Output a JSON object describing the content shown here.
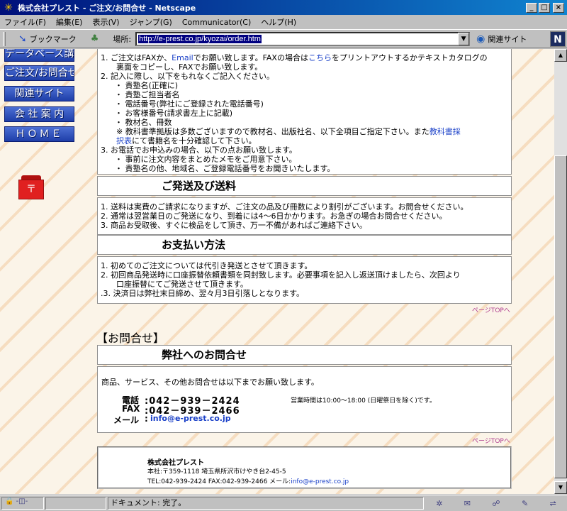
{
  "window": {
    "title": "株式会社プレスト - ご注文/お問合せ - Netscape"
  },
  "menu": [
    "ファイル(F)",
    "編集(E)",
    "表示(V)",
    "ジャンプ(G)",
    "Communicator(C)",
    "ヘルプ(H)"
  ],
  "toolbar": {
    "bookmark_label": "ブックマーク",
    "location_label": "場所:",
    "url": "http://e-prest.co.jp/kyozai/order.htm",
    "related_label": "関連サイト"
  },
  "nav": [
    "データベース講習",
    "ご注文/お問合せ",
    "関連サイト",
    "会 社 案 内",
    "ＨＯＭＥ"
  ],
  "order_steps": {
    "l1a": "1.  ご注文はFAXか、",
    "l1_email": "Email",
    "l1b": "でお願い致します。FAXの場合は",
    "l1_here": "こちら",
    "l1c": "をプリントアウトするかテキストカタログの",
    "l1d": "裏面をコピーし、FAXでお願い致します。",
    "l2": "2.  記入に際し、以下をもれなくご記入ください。",
    "b1": "・ 貴塾名(正確に)",
    "b2": "・ 貴塾ご担当者名",
    "b3": "・ 電話番号(弊社にご登録された電話番号)",
    "b4": "・ お客様番号(請求書左上に記載)",
    "b5": "・ 教材名、冊数",
    "note_a": "※ 教科書準拠版は多数ございますので教材名、出版社名、以下全項目ご指定下さい。また",
    "note_link1": "教科書採",
    "note_link2": "択表",
    "note_b": "にて書籍名を十分確認して下さい。",
    "l3": "3.  お電話でお申込みの場合、以下の点お願い致します。",
    "c1": "・ 事前に注文内容をまとめたメモをご用意下さい。",
    "c2": "・ 貴塾名の他、地域名、ご登録電話番号をお聞きいたします。"
  },
  "shipping": {
    "heading": "ご発送及び送料",
    "items": [
      "1.  送料は実費のご請求になりますが、ご注文の品及び冊数により割引がございます。お問合せください。",
      "2.  通常は翌営業日のご発送になり、到着には4～6日かかります。お急ぎの場合お問合せください。",
      "3.  商品お受取後、すぐに検品をして頂き、万一不備があればご連絡下さい。"
    ]
  },
  "payment": {
    "heading": "お支払い方法",
    "i1": "1.  初めてのご注文については代引き発送とさせて頂きます。",
    "i2a": "2.  初回商品発送時に口座振替依頼書類を同封致します。必要事項を記入し返送頂けましたら、次回より",
    "i2b": "口座振替にてご発送させて頂きます。",
    "i3": ".3.  決済日は弊社末日締め、翌々月3日引落しとなります。"
  },
  "pagetop": "ページTOPへ",
  "inquiry": {
    "section_title": "【お問合せ】",
    "heading": "弊社へのお問合せ",
    "intro": "商品、サービス、その他お問合せは以下までお願い致します。",
    "tel_label": "電話",
    "tel": ":042－939－2424",
    "fax_label": "FAX",
    "fax": ":042－939－2466",
    "mail_label": "メール",
    "mail_colon": ":",
    "mail": "info@e-prest.co.jp",
    "hours": "営業時間は10:00～18:00 (日曜祭日を除く)です。"
  },
  "footer": {
    "company": "株式会社プレスト",
    "address": "本社:〒359-1118 埼玉県所沢市けやき台2-45-5",
    "contact": "TEL:042-939-2424  FAX:042-939-2466  メール:",
    "mail": "info@e-prest.co.jp"
  },
  "status": {
    "text": "ドキュメント: 完了。"
  }
}
